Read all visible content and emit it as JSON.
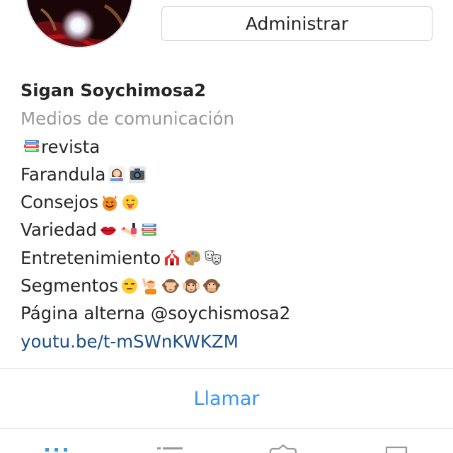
{
  "profile": {
    "manage_label": "Administrar",
    "name": "Sigan Soychimosa2",
    "category": "Medios de comunicación",
    "bio_lines": [
      {
        "text": "revista",
        "emojis_before": [
          "books-icon"
        ],
        "emojis_after": []
      },
      {
        "text": "Farandula",
        "emojis_before": [],
        "emojis_after": [
          "woman-nail-polish-icon",
          "camera-icon"
        ]
      },
      {
        "text": "Consejos ",
        "emojis_before": [],
        "emojis_after": [
          "smiling-devil-icon",
          "tongue-face-icon"
        ]
      },
      {
        "text": "Variedad",
        "emojis_before": [],
        "emojis_after": [
          "lips-icon",
          "nail-polish-icon",
          "books-icon"
        ]
      },
      {
        "text": "Entretenimiento ",
        "emojis_before": [],
        "emojis_after": [
          "circus-tent-icon",
          "palette-icon",
          "theater-masks-icon"
        ]
      },
      {
        "text": "Segmentos ",
        "emojis_before": [],
        "emojis_after": [
          "unamused-face-icon",
          "person-raising-hand-icon",
          "see-no-evil-monkey-icon",
          "hear-no-evil-monkey-icon",
          "speak-no-evil-monkey-icon"
        ]
      },
      {
        "text": "Página alterna @soychismosa2",
        "emojis_before": [],
        "emojis_after": []
      }
    ],
    "link": "youtu.be/t-mSWnKWKZM",
    "link_color": "#1a4f8b"
  },
  "actions": {
    "call_label": "Llamar",
    "call_color": "#3897f0"
  },
  "tabbar": {
    "tabs": [
      "grid-view-icon",
      "list-view-icon",
      "tagged-icon",
      "saved-icon"
    ],
    "active_color": "#3897f0"
  }
}
